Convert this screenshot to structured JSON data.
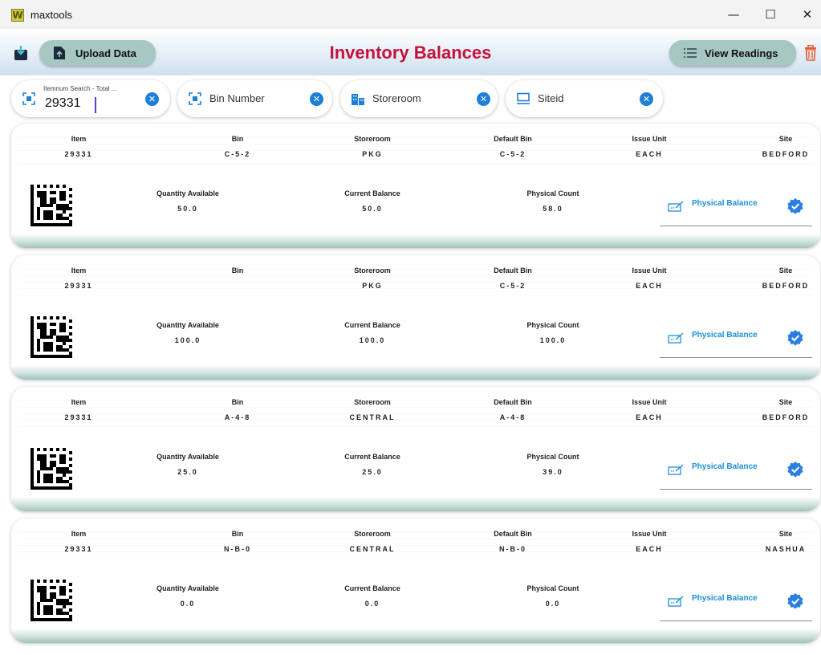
{
  "window": {
    "title": "maxtools",
    "logo_letter": "W",
    "min": "—",
    "max": "☐",
    "close": "✕"
  },
  "header": {
    "upload_label": "Upload Data",
    "title": "Inventory Balances",
    "view_label": "View Readings"
  },
  "search": {
    "item": {
      "label": "Itemnum Search - Total ...",
      "value": "29331"
    },
    "bin": {
      "placeholder": "Bin Number"
    },
    "storeroom": {
      "placeholder": "Storeroom"
    },
    "site": {
      "placeholder": "Siteid"
    },
    "clear_glyph": "✕"
  },
  "labels": {
    "item": "Item",
    "bin": "Bin",
    "storeroom": "Storeroom",
    "default_bin": "Default Bin",
    "issue_unit": "Issue Unit",
    "site": "Site",
    "qty_available": "Quantity Available",
    "current_balance": "Current Balance",
    "physical_count": "Physical Count",
    "physical_balance": "Physical Balance"
  },
  "cards": [
    {
      "item": "29331",
      "bin": "C-5-2",
      "storeroom": "PKG",
      "default_bin": "C-5-2",
      "issue_unit": "EACH",
      "site": "BEDFORD",
      "qty_available": "50.0",
      "current_balance": "50.0",
      "physical_count": "58.0"
    },
    {
      "item": "29331",
      "bin": "",
      "storeroom": "PKG",
      "default_bin": "C-5-2",
      "issue_unit": "EACH",
      "site": "BEDFORD",
      "qty_available": "100.0",
      "current_balance": "100.0",
      "physical_count": "100.0"
    },
    {
      "item": "29331",
      "bin": "A-4-8",
      "storeroom": "CENTRAL",
      "default_bin": "A-4-8",
      "issue_unit": "EACH",
      "site": "BEDFORD",
      "qty_available": "25.0",
      "current_balance": "25.0",
      "physical_count": "39.0"
    },
    {
      "item": "29331",
      "bin": "N-B-0",
      "storeroom": "CENTRAL",
      "default_bin": "N-B-0",
      "issue_unit": "EACH",
      "site": "NASHUA",
      "qty_available": "0.0",
      "current_balance": "0.0",
      "physical_count": "0.0"
    }
  ],
  "colors": {
    "title": "#c6113a",
    "accent_blue": "#1e7fd8",
    "pill": "#a7c7c2",
    "trash": "#e25b2f"
  }
}
